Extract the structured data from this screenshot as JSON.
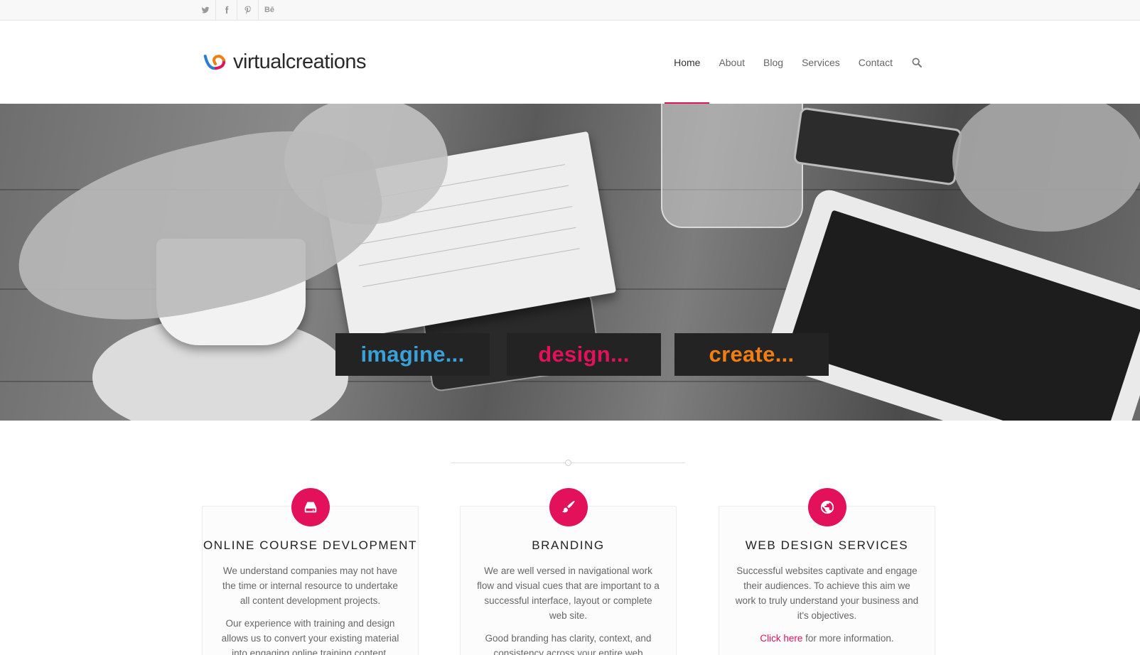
{
  "topbar": {
    "social": [
      {
        "name": "twitter"
      },
      {
        "name": "facebook"
      },
      {
        "name": "pinterest"
      },
      {
        "name": "behance",
        "label": "Bē"
      }
    ]
  },
  "header": {
    "logo_text": "virtualcreations",
    "nav": [
      {
        "label": "Home",
        "active": true
      },
      {
        "label": "About"
      },
      {
        "label": "Blog"
      },
      {
        "label": "Services"
      },
      {
        "label": "Contact"
      }
    ],
    "search_icon": "search-icon"
  },
  "hero": {
    "tiles": [
      {
        "label": "imagine...",
        "color": "#3aa0d8"
      },
      {
        "label": "design...",
        "color": "#e3105a"
      },
      {
        "label": "create...",
        "color": "#f07e12"
      }
    ]
  },
  "services": [
    {
      "icon": "drive-icon",
      "title": "ONLINE COURSE DEVLOPMENT",
      "paragraphs": [
        "We understand companies may not have the time or internal resource to undertake all content development projects.",
        "Our experience with training and design allows us to convert your existing material into engaging online training content."
      ]
    },
    {
      "icon": "brush-icon",
      "title": "BRANDING",
      "paragraphs": [
        "We are well versed in navigational work flow and visual cues that are important to a successful interface, layout or complete web site.",
        "Good branding has clarity, context, and consistency across your entire web"
      ]
    },
    {
      "icon": "globe-icon",
      "title": "WEB DESIGN SERVICES",
      "paragraphs": [
        "Successful websites captivate and engage their audiences. To achieve this aim we work to truly understand your business and it's objectives."
      ],
      "link_text": "Click here",
      "link_suffix": " for more information."
    }
  ],
  "colors": {
    "accent": "#e3105a",
    "imagine": "#3aa0d8",
    "create": "#f07e12"
  }
}
